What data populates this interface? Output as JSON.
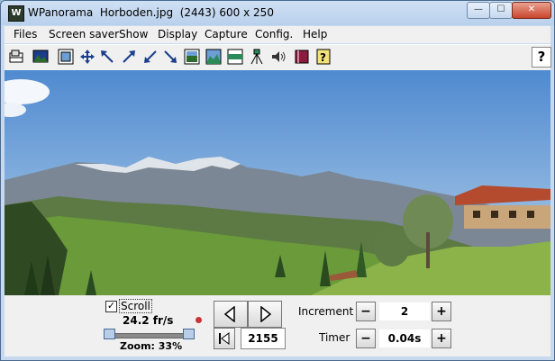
{
  "window": {
    "title": "WPanorama  Horboden.jpg  (2443) 600 x 250",
    "app_icon_glyph": "W",
    "minimize_glyph": "—",
    "maximize_glyph": "☐",
    "close_glyph": "✕"
  },
  "menu": {
    "items": [
      "Files",
      "Screen saver",
      "Show",
      "Display",
      "Capture",
      "Config.",
      "Help"
    ]
  },
  "toolbar": {
    "buttons": [
      "open-icon",
      "picture-icon",
      "fit-icon",
      "move-icon",
      "arrow-upleft-icon",
      "arrow-upright-icon",
      "arrow-downleft-icon",
      "arrow-downright-icon",
      "full-height-icon",
      "landscape-icon",
      "width-icon",
      "tripod-icon",
      "sound-icon",
      "book-icon",
      "help-doc-icon"
    ],
    "help_label": "?"
  },
  "controls": {
    "scroll_checked": true,
    "check_glyph": "✓",
    "scroll_label": "Scroll",
    "fps": "24.2 fr/s",
    "zoom": "Zoom: 33%",
    "frame_number": "2155",
    "increment_label": "Increment",
    "increment_value": "2",
    "timer_label": "Timer",
    "timer_value": "0.04s",
    "minus_glyph": "−",
    "plus_glyph": "+"
  },
  "colors": {
    "sky": "#6c9fd6",
    "mountain": "#7b8794",
    "meadow": "#6a9a3a",
    "roof": "#b44a2e"
  }
}
